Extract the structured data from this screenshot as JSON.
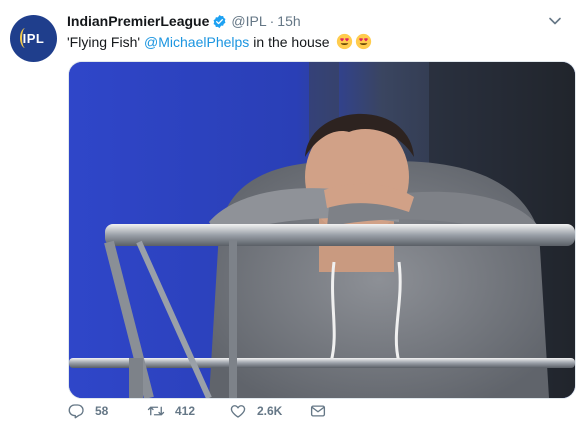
{
  "account": {
    "name": "IndianPremierLeague",
    "handle": "@IPL",
    "separator": "·",
    "time": "15h",
    "avatar_text": "IPL"
  },
  "tweet": {
    "text_before": "'Flying Fish'",
    "mention": "@MichaelPhelps",
    "text_after": "in the house",
    "emojis": [
      "heart-eyes-emoji",
      "heart-eyes-emoji"
    ]
  },
  "actions": {
    "replies": "58",
    "retweets": "412",
    "likes": "2.6K"
  },
  "colors": {
    "link": "#1b95e0",
    "muted": "#657786",
    "avatar_bg": "#1f3e8c",
    "photo_bg": "#2a3db5"
  }
}
